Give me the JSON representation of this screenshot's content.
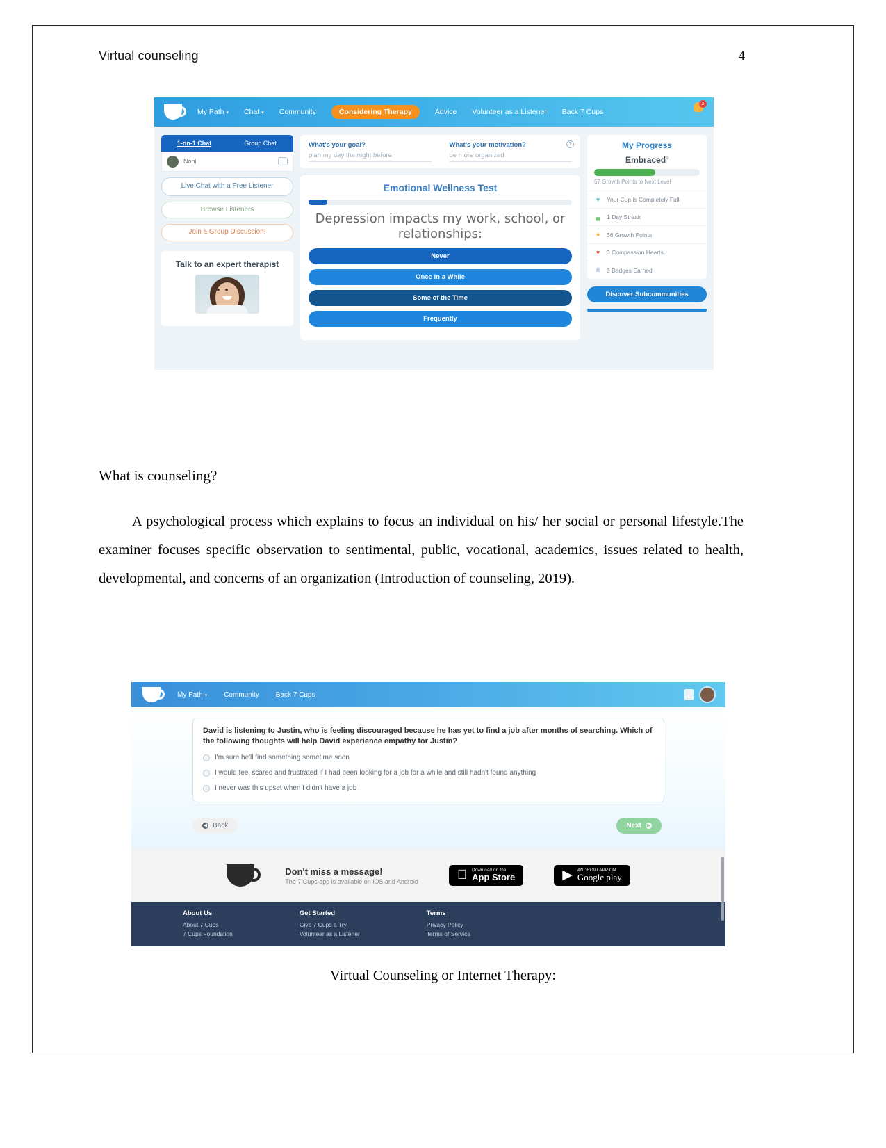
{
  "document": {
    "header_title": "Virtual counseling",
    "page_number": "4",
    "heading": "What is counseling?",
    "paragraph": "A psychological process which explains to focus an individual on his/ her social or personal lifestyle.The examiner focuses specific observation to sentimental, public, vocational, academics, issues related to health, developmental, and concerns of an organization (Introduction of counseling, 2019).",
    "figure2_caption": "Virtual Counseling or Internet Therapy:",
    "stray_mark": "."
  },
  "figure1": {
    "nav": [
      {
        "label": "My Path",
        "caret": "▾",
        "active": false
      },
      {
        "label": "Chat",
        "caret": "▾",
        "active": false
      },
      {
        "label": "Community",
        "caret": "",
        "active": false
      },
      {
        "label": "Considering Therapy",
        "caret": "",
        "active": true
      },
      {
        "label": "Advice",
        "caret": "",
        "active": false
      },
      {
        "label": "Volunteer as a Listener",
        "caret": "",
        "active": false
      },
      {
        "label": "Back 7 Cups",
        "caret": "",
        "active": false
      }
    ],
    "notification_count": "2",
    "sidebar": {
      "tab_one_on_one": "1-on-1 Chat",
      "tab_group": "Group Chat",
      "contact_name": "Noni",
      "buttons": [
        {
          "label": "Live Chat with a Free Listener",
          "style": "blue"
        },
        {
          "label": "Browse Listeners",
          "style": "green"
        },
        {
          "label": "Join a Group Discussion!",
          "style": "orange"
        }
      ],
      "therapist_title": "Talk to an expert therapist"
    },
    "goal_card": {
      "goal_question": "What's your goal?",
      "goal_answer": "plan my day the night before",
      "motivation_question": "What's your motivation?",
      "motivation_answer": "be more organized",
      "info_icon": "?"
    },
    "wellness_test": {
      "title": "Emotional Wellness Test",
      "progress_percent": 7,
      "question": "Depression impacts my work, school, or relationships:",
      "answers": [
        {
          "label": "Never",
          "color": "#1565c0"
        },
        {
          "label": "Once in a While",
          "color": "#1e87dd"
        },
        {
          "label": "Some of the Time",
          "color": "#13558f"
        },
        {
          "label": "Frequently",
          "color": "#1e87dd"
        }
      ]
    },
    "progress": {
      "title": "My Progress",
      "level": "Embraced",
      "level_sup": "0",
      "bar_percent": 58,
      "next_level_text": "57 Growth Points to Next Level",
      "rows": [
        {
          "icon": "♥",
          "icon_color": "#4fc3d9",
          "label": "Your Cup is Completely Full"
        },
        {
          "icon": "▄",
          "icon_color": "#7ac47a",
          "label": "1 Day Streak"
        },
        {
          "icon": "★",
          "icon_color": "#f5a623",
          "label": "36 Growth Points"
        },
        {
          "icon": "♥",
          "icon_color": "#e23b3b",
          "label": "3 Compassion Hearts"
        },
        {
          "icon": "♕",
          "icon_color": "#3f73b5",
          "label": "3 Badges Earned"
        }
      ],
      "discover_button": "Discover Subcommunities"
    }
  },
  "figure2": {
    "nav": [
      {
        "label": "My Path",
        "caret": "▾"
      },
      {
        "label": "Community",
        "caret": ""
      },
      {
        "label": "Back 7 Cups",
        "caret": ""
      }
    ],
    "quiz": {
      "question": "David is listening to Justin, who is feeling discouraged because he has yet to find a job after months of searching. Which of the following thoughts will help David experience empathy for Justin?",
      "options": [
        "I'm sure he'll find something sometime soon",
        "I would feel scared and frustrated if I had been looking for a job for a while and still hadn't found anything",
        "I never was this upset when I didn't have a job"
      ],
      "back_button": "Back",
      "next_button": "Next",
      "back_icon": "◀",
      "next_icon": "▶"
    },
    "promo": {
      "headline": "Don't miss a message!",
      "subline": "The 7 Cups app is available on iOS and Android",
      "appstore_small": "Download on the",
      "appstore_big": "App Store",
      "googleplay_small": "ANDROID APP ON",
      "googleplay_big": "Google play"
    },
    "footer": [
      {
        "heading": "About Us",
        "items": [
          "About 7 Cups",
          "7 Cups Foundation"
        ]
      },
      {
        "heading": "Get Started",
        "items": [
          "Give 7 Cups a Try",
          "Volunteer as a Listener"
        ]
      },
      {
        "heading": "Terms",
        "items": [
          "Privacy Policy",
          "Terms of Service"
        ]
      }
    ]
  }
}
